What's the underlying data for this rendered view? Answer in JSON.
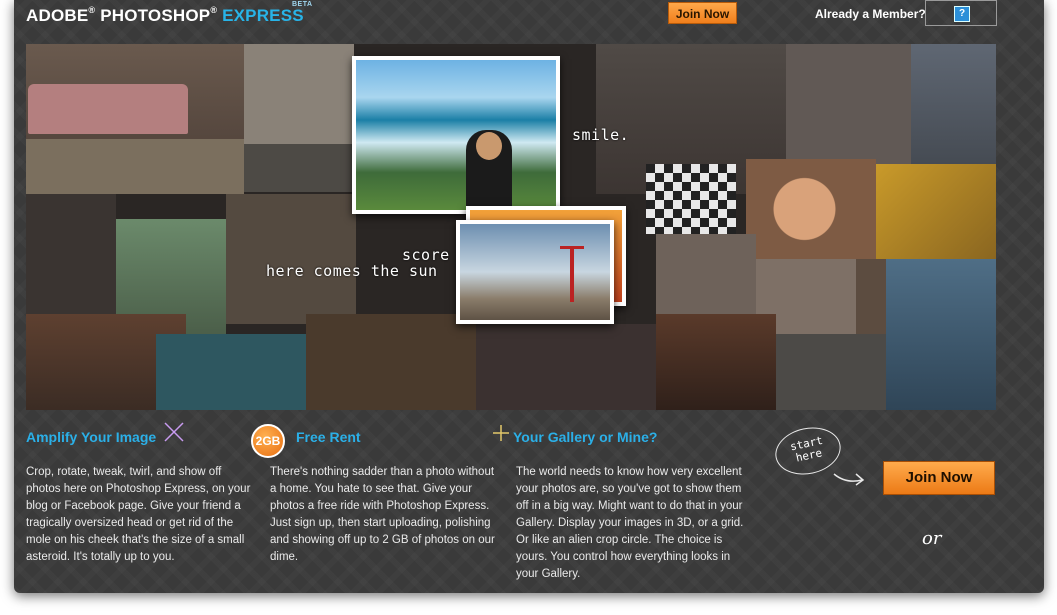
{
  "header": {
    "logo_adobe": "ADOBE",
    "logo_photoshop": "PHOTOSHOP",
    "logo_express": "EXPRESS",
    "logo_beta": "BETA",
    "join_label": "Join Now",
    "member_label": "Already a Member?",
    "help_icon": "?"
  },
  "collage": {
    "captions": [
      "smile.",
      "score",
      "here comes the sun"
    ]
  },
  "features": [
    {
      "title": "Amplify Your Image",
      "icon": "crop-sparkle-icon",
      "body": "Crop, rotate, tweak, twirl, and show off photos here on  Photoshop Express, on your blog or Facebook page. Give your friend a tragically oversized head or get rid of the mole on his cheek that's the size of a small asteroid. It's totally up to you."
    },
    {
      "title": "Free Rent",
      "badge": "2GB",
      "body": "There's nothing sadder than a photo without a home. You hate to see that. Give your photos a free ride with Photoshop Express. Just sign up, then start uploading, polishing and showing off up to 2 GB of photos on our dime."
    },
    {
      "title": "Your Gallery or Mine?",
      "icon": "crosshair-icon",
      "body": "The world needs to know how very excellent your photos are, so you've got to show them off in a big way. Might want to do that in your Gallery. Display your images in 3D, or a grid. Or like an alien crop circle. The choice is yours. You control how everything looks in your Gallery."
    }
  ],
  "cta": {
    "start_here": "start here",
    "join_label": "Join Now",
    "or_label": "or"
  },
  "colors": {
    "accent_blue": "#2bb0e8",
    "button_orange": "#f08a24",
    "background": "#3a3a3a"
  }
}
